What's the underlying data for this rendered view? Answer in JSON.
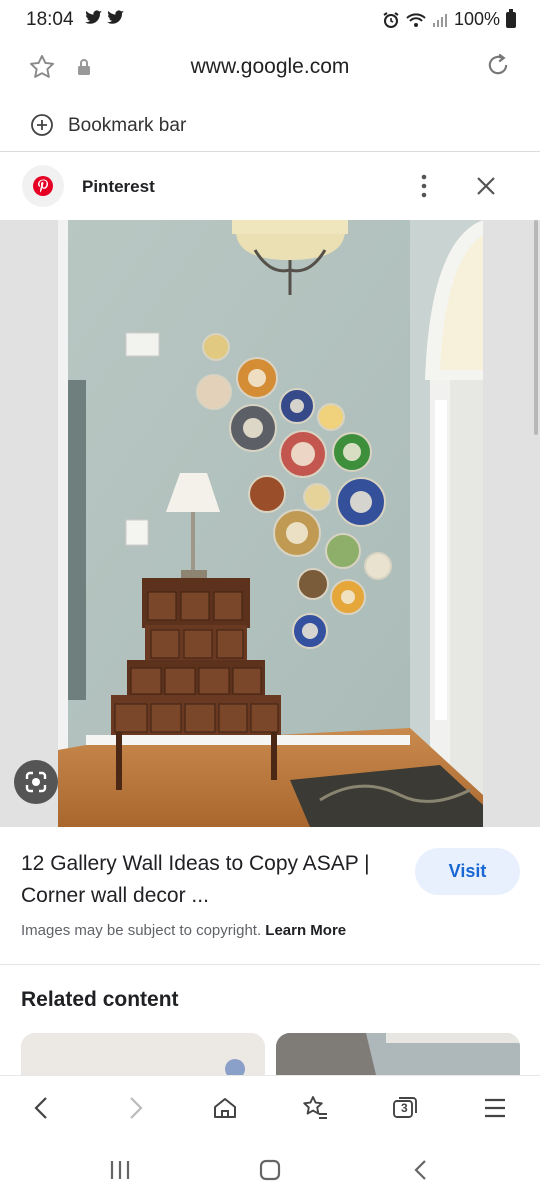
{
  "status_bar": {
    "time": "18:04",
    "left_icons": "🐦🐦",
    "battery": "100%"
  },
  "browser": {
    "url": "www.google.com",
    "bookmark_label": "Bookmark bar"
  },
  "source": {
    "name": "Pinterest",
    "brand_color": "#e60023"
  },
  "result": {
    "title": "12 Gallery Wall Ideas to Copy ASAP | Corner wall decor ...",
    "visit_label": "Visit",
    "copyright_text": "Images may be subject to copyright.",
    "learn_more": "Learn More"
  },
  "related": {
    "title": "Related content"
  },
  "toolbar": {
    "tabs_count": "3"
  },
  "icons": {
    "star": "star-outline-icon",
    "lock": "lock-icon",
    "reload": "reload-icon",
    "add": "plus-circle-icon",
    "more": "more-vertical-icon",
    "close": "close-icon",
    "lens": "google-lens-icon"
  }
}
